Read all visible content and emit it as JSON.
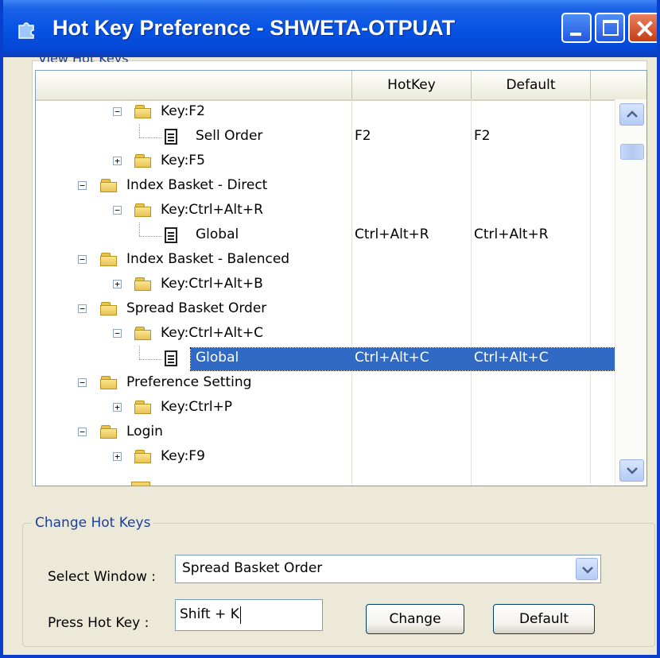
{
  "window": {
    "title": "Hot Key Preference - SHWETA-OTPUAT",
    "controls": {
      "minimize": "minimize-icon",
      "maximize": "maximize-icon",
      "close": "close-icon"
    }
  },
  "view_group": {
    "legend": "View Hot Keys"
  },
  "grid": {
    "columns": [
      "HotKey",
      "Default"
    ],
    "rows": [
      {
        "type": "key",
        "label": "Key:F2",
        "expander": "−",
        "hotkey": "",
        "default": ""
      },
      {
        "type": "item",
        "label": "Sell Order",
        "hotkey": "F2",
        "default": "F2"
      },
      {
        "type": "key",
        "label": "Key:F5",
        "expander": "+",
        "hotkey": "",
        "default": ""
      },
      {
        "type": "window",
        "label": "Index Basket - Direct",
        "expander": "−",
        "hotkey": "",
        "default": ""
      },
      {
        "type": "key",
        "label": "Key:Ctrl+Alt+R",
        "expander": "−",
        "hotkey": "",
        "default": ""
      },
      {
        "type": "item",
        "label": "Global",
        "hotkey": "Ctrl+Alt+R",
        "default": "Ctrl+Alt+R"
      },
      {
        "type": "window",
        "label": "Index Basket - Balenced",
        "expander": "−",
        "hotkey": "",
        "default": ""
      },
      {
        "type": "key",
        "label": "Key:Ctrl+Alt+B",
        "expander": "+",
        "hotkey": "",
        "default": ""
      },
      {
        "type": "window",
        "label": "Spread Basket Order",
        "expander": "−",
        "hotkey": "",
        "default": ""
      },
      {
        "type": "key",
        "label": "Key:Ctrl+Alt+C",
        "expander": "−",
        "hotkey": "",
        "default": ""
      },
      {
        "type": "item",
        "label": "Global",
        "hotkey": "Ctrl+Alt+C",
        "default": "Ctrl+Alt+C",
        "selected": true
      },
      {
        "type": "window",
        "label": "Preference Setting",
        "expander": "−",
        "hotkey": "",
        "default": ""
      },
      {
        "type": "key",
        "label": "Key:Ctrl+P",
        "expander": "+",
        "hotkey": "",
        "default": ""
      },
      {
        "type": "window",
        "label": "Login",
        "expander": "−",
        "hotkey": "",
        "default": ""
      },
      {
        "type": "key",
        "label": "Key:F9",
        "expander": "+",
        "hotkey": "",
        "default": ""
      }
    ]
  },
  "change_group": {
    "legend": "Change Hot Keys",
    "select_window_label": "Select Window :",
    "select_window_value": "Spread Basket Order",
    "press_hot_key_label": "Press Hot Key :",
    "press_hot_key_value": "Shift + K",
    "change_button": "Change",
    "default_button": "Default"
  },
  "colors": {
    "title_bar": "#0753E3",
    "selection": "#316AC5",
    "group_legend": "#1E3E9C",
    "dialog_bg": "#ECE9D8"
  }
}
